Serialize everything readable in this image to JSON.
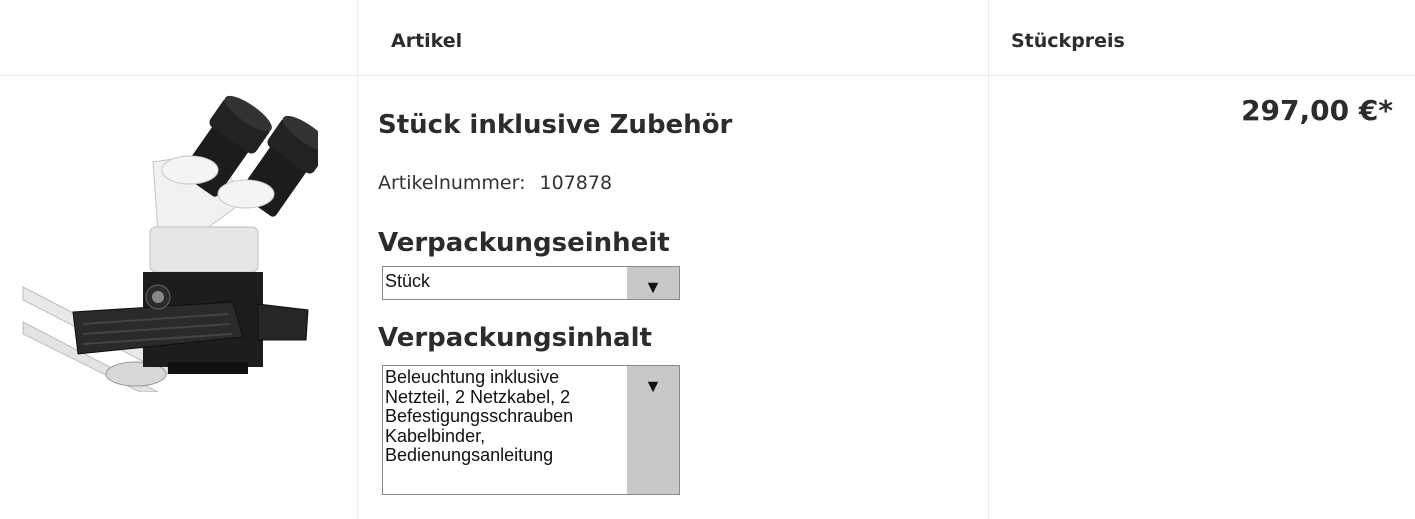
{
  "table": {
    "header": {
      "article_col": "Artikel",
      "price_col": "Stückpreis"
    },
    "row": {
      "image_alt": "microscope-product-image",
      "title": "Stück inklusive Zubehör",
      "article_number_label": "Artikelnummer:",
      "article_number": "107878",
      "packaging_unit": {
        "label": "Verpackungseinheit",
        "selected": "Stück"
      },
      "packaging_content": {
        "label": "Verpackungsinhalt",
        "lines": [
          "Beleuchtung inklusive",
          "Netzteil, 2 Netzkabel, 2",
          "Befestigungsschrauben",
          "Kabelbinder,",
          "Bedienungsanleitung"
        ]
      },
      "price": "297,00 €*"
    }
  },
  "icons": {
    "dropdown": "chevron-down-icon"
  },
  "colors": {
    "border": "#ececec",
    "select_button": "#c8c8c8",
    "text": "#2c2c2c"
  }
}
